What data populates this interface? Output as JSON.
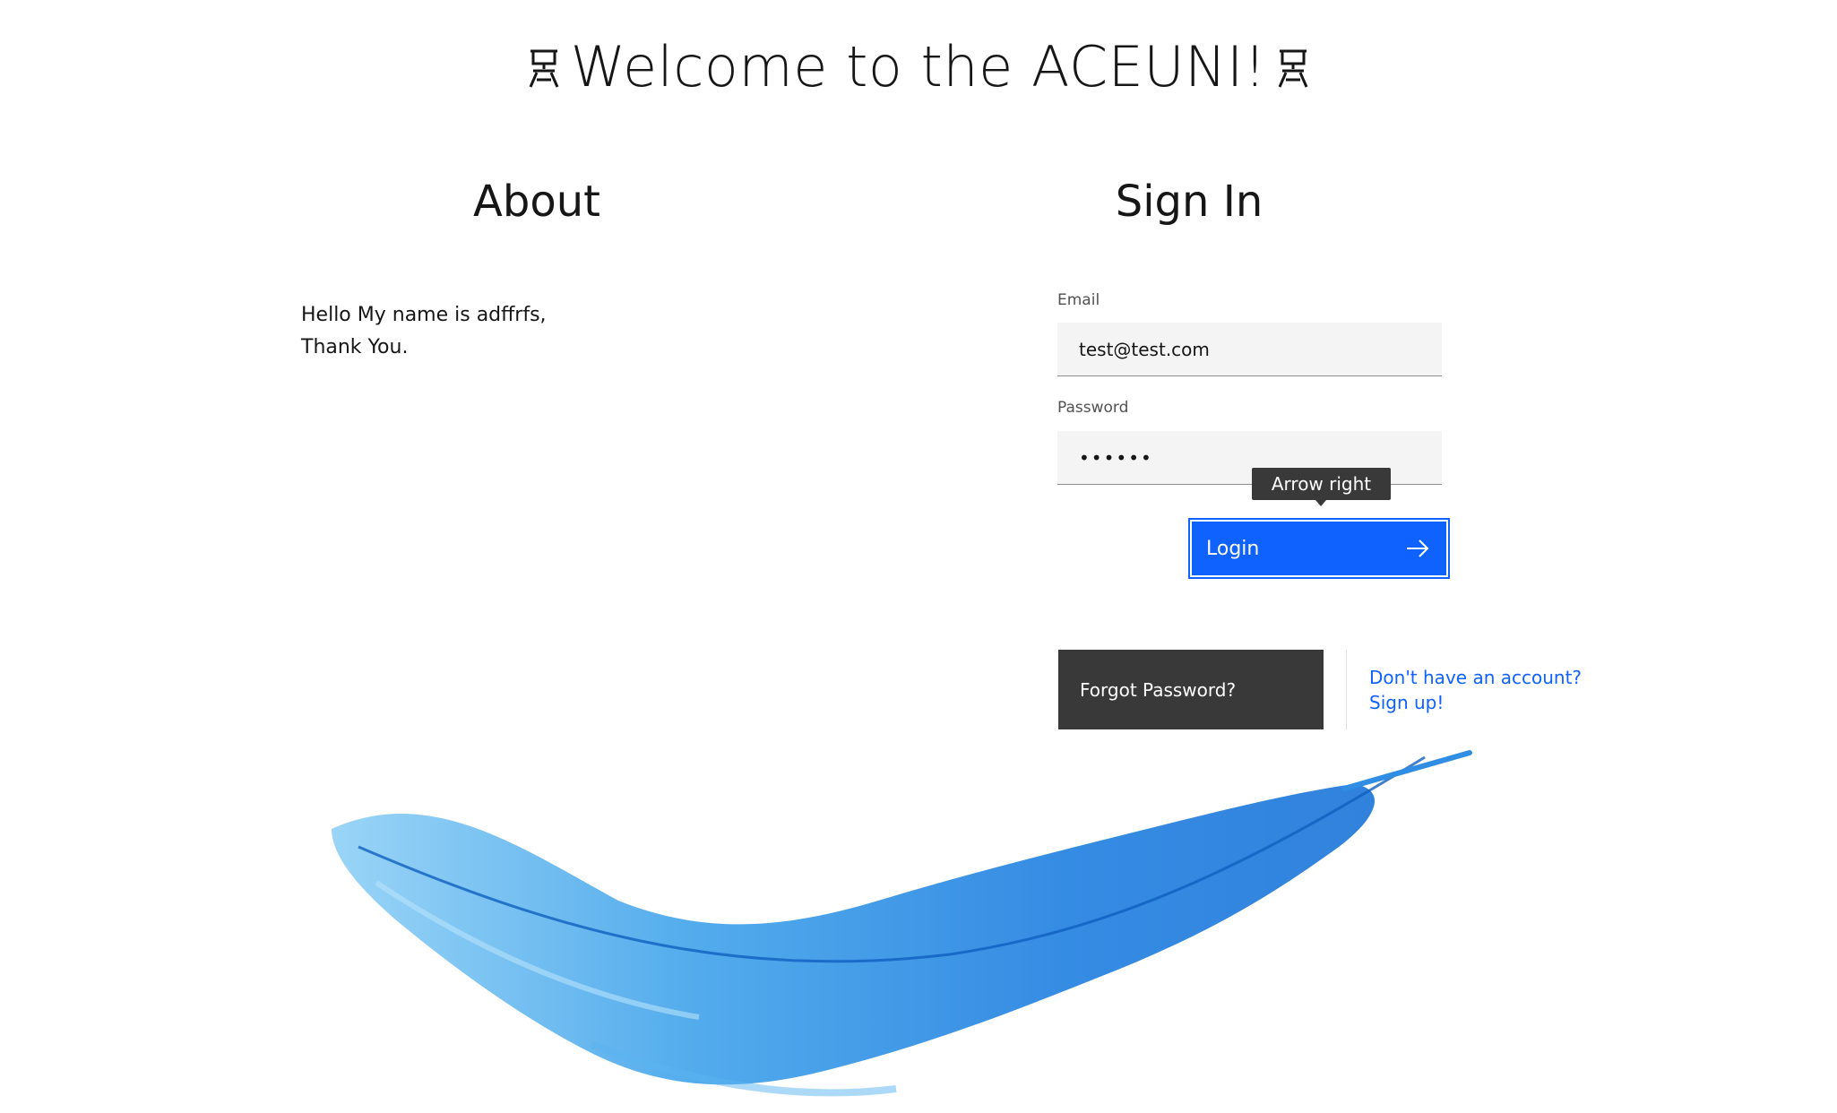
{
  "header": {
    "title": "Welcome to the ACEUNI!",
    "logo_icon": "aceuni-glyph-icon"
  },
  "about": {
    "heading": "About",
    "line1": "Hello My name is adffrfs,",
    "line2": "Thank You."
  },
  "signin": {
    "heading": "Sign In",
    "email_label": "Email",
    "email_value": "test@test.com",
    "password_label": "Password",
    "password_value": "••••••",
    "tooltip": "Arrow right",
    "login_label": "Login",
    "login_icon": "arrow-right-icon",
    "forgot_label": "Forgot Password?",
    "signup_line1": "Don't have an account?",
    "signup_line2": "Sign up!"
  },
  "colors": {
    "primary": "#0f62fe",
    "dark": "#393939",
    "field_bg": "#f4f4f4",
    "feather": "#2f8de4"
  },
  "illustration": {
    "icon": "blue-feather-illustration"
  }
}
